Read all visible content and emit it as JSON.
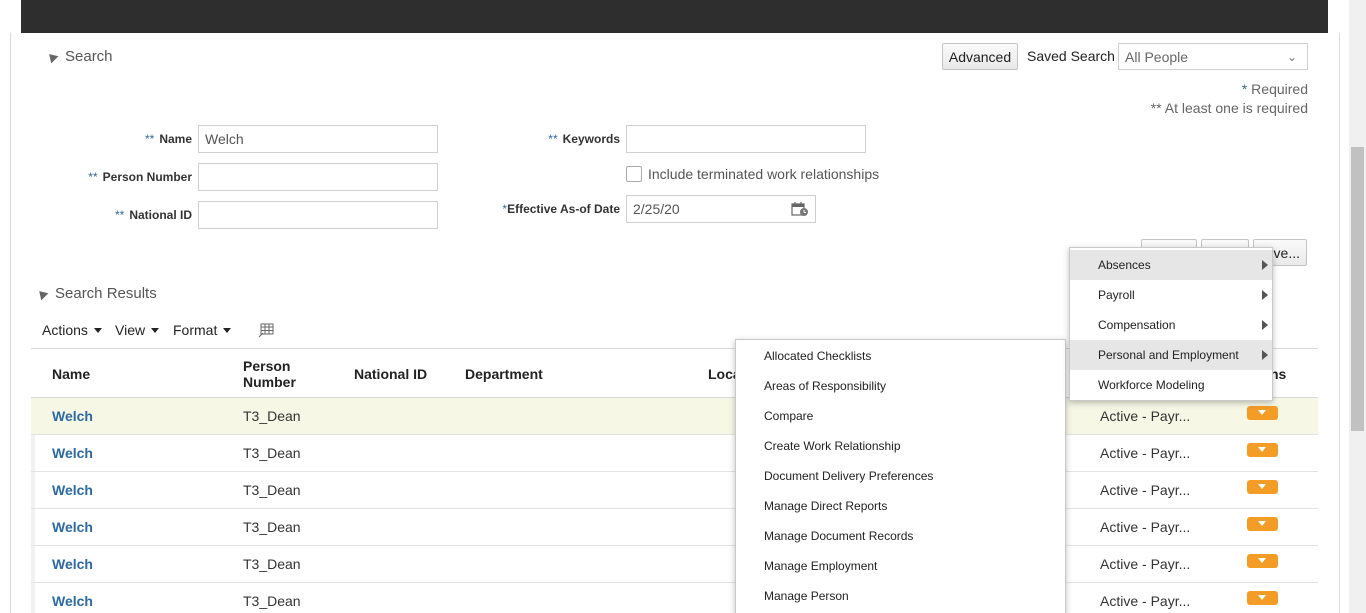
{
  "search": {
    "title": "Search",
    "advanced_label": "Advanced",
    "saved_search_label": "Saved Search",
    "saved_search_value": "All People",
    "required_note": "Required",
    "required_star": "*",
    "at_least_one_note": "** At least one is required",
    "double_star": "**",
    "single_star": "*",
    "fields": {
      "name_label": "Name",
      "name_value": "Welch",
      "person_number_label": "Person Number",
      "national_id_label": "National ID",
      "keywords_label": "Keywords",
      "include_terminated_label": "Include terminated work relationships",
      "effective_date_label": "Effective As-of Date",
      "effective_date_value": "2/25/20"
    },
    "save_button_partial": "ve..."
  },
  "results": {
    "title": "Search Results",
    "toolbar": {
      "actions": "Actions",
      "view": "View",
      "format": "Format"
    },
    "columns": {
      "name": "Name",
      "person_number_1": "Person",
      "person_number_2": "Number",
      "national_id": "National ID",
      "department": "Department",
      "location_partial": "Loca",
      "actions_partial": "ns"
    },
    "rows": [
      {
        "name": "Welch",
        "person_number": "T3_Dean",
        "status": "Active - Payr..."
      },
      {
        "name": "Welch",
        "person_number": "T3_Dean",
        "status": "Active - Payr..."
      },
      {
        "name": "Welch",
        "person_number": "T3_Dean",
        "status": "Active - Payr..."
      },
      {
        "name": "Welch",
        "person_number": "T3_Dean",
        "status": "Active - Payr..."
      },
      {
        "name": "Welch",
        "person_number": "T3_Dean",
        "status": "Active - Payr..."
      },
      {
        "name": "Welch",
        "person_number": "T3_Dean",
        "status": "Active - Payr..."
      }
    ]
  },
  "main_menu": [
    {
      "label": "Absences",
      "has_submenu": true
    },
    {
      "label": "Payroll",
      "has_submenu": true
    },
    {
      "label": "Compensation",
      "has_submenu": true
    },
    {
      "label": "Personal and Employment",
      "has_submenu": true
    },
    {
      "label": "Workforce Modeling",
      "has_submenu": false
    }
  ],
  "sub_menu": [
    {
      "label": "Allocated Checklists"
    },
    {
      "label": "Areas of Responsibility"
    },
    {
      "label": "Compare"
    },
    {
      "label": "Create Work Relationship"
    },
    {
      "label": "Document Delivery Preferences"
    },
    {
      "label": "Manage Direct Reports"
    },
    {
      "label": "Manage Document Records"
    },
    {
      "label": "Manage Employment"
    },
    {
      "label": "Manage Person"
    }
  ],
  "colors": {
    "link": "#2b6aa3",
    "accent_orange": "#f39c26",
    "top_bar": "#2e2e2e"
  }
}
